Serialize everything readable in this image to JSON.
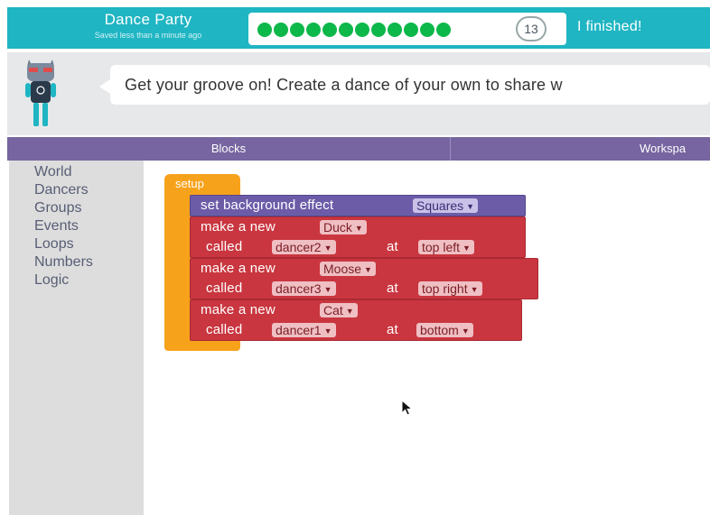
{
  "header": {
    "title": "Dance Party",
    "save_status": "Saved less than a minute ago",
    "level_number": "13",
    "finished_label": "I finished!",
    "completed_dots": 12,
    "dot_color": "#0db84a"
  },
  "instructions": {
    "text": "Get your groove on! Create a dance of your own to share w"
  },
  "tabs": {
    "blocks": "Blocks",
    "workspace": "Workspa"
  },
  "toolbox": {
    "categories": [
      "World",
      "Dancers",
      "Groups",
      "Events",
      "Loops",
      "Numbers",
      "Logic"
    ]
  },
  "workspace": {
    "setup": "setup",
    "background": {
      "label": "set background effect",
      "value": "Squares"
    },
    "make_new_label": "make a new",
    "called_label": "called",
    "at_label": "at",
    "dancers": [
      {
        "type": "Duck",
        "name": "dancer2",
        "location": "top left"
      },
      {
        "type": "Moose",
        "name": "dancer3",
        "location": "top right"
      },
      {
        "type": "Cat",
        "name": "dancer1",
        "location": "bottom"
      }
    ]
  },
  "colors": {
    "header": "#1fb5c3",
    "tabbar": "#7665a0",
    "event_block": "#f7a21b",
    "world_block": "#6c5ca8",
    "dancer_block": "#c9363f"
  }
}
